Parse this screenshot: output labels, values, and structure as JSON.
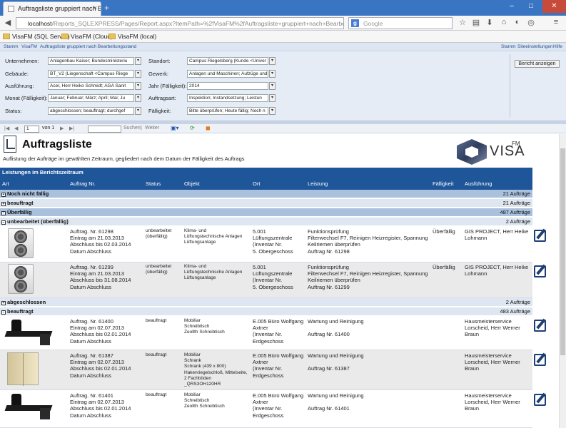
{
  "browser": {
    "tab_title": "Auftragsliste gruppiert nach Be...",
    "url_host": "localhost",
    "url_path": "/Reports_SQLEXPRESS/Pages/Report.aspx?ItemPath=%2fVisaFM%2fAuftragsliste+gruppiert+nach+Bearbeitungsstand&",
    "search_placeholder": "Google",
    "win_min": "–",
    "win_max": "□",
    "win_close": "✕",
    "tab_close": "×",
    "new_tab": "+",
    "bookmarks": [
      "VisaFM (SQL Server)",
      "VisaFM (Cloud)",
      "VisaFM (local)"
    ]
  },
  "crumbs": {
    "left": [
      "Stamm",
      "VisaFM",
      "Auftragsliste gruppiert nach Bearbeitungsstand"
    ],
    "right": [
      "Stamm",
      "Siteeinstellungen",
      "Hilfe"
    ]
  },
  "params": {
    "left": [
      {
        "label": "Unternehmen:",
        "value": "Anlagenbau Kaiser; Bundesministeriu"
      },
      {
        "label": "Gebäude:",
        "value": "BT_V2 (Liegenschaft <Campus Riege"
      },
      {
        "label": "Ausführung:",
        "value": "Acer, Herr Heiko Schmidt; AGA Sanit"
      },
      {
        "label": "Monat (Fälligkeit):",
        "value": "Januar; Februar; März; April; Mai; Ju"
      },
      {
        "label": "Status:",
        "value": "abgeschlossen; beauftragt; durchgef"
      }
    ],
    "right": [
      {
        "label": "Standort:",
        "value": "Campus Riegelsberg (Kunde <Univer"
      },
      {
        "label": "Gewerk:",
        "value": "Anlagen und Maschinen; Aufzüge und"
      },
      {
        "label": "Jahr (Fälligkeit):",
        "value": "2014"
      },
      {
        "label": "Auftragsart:",
        "value": "Inspektion; Instandsetzung; Leistun"
      },
      {
        "label": "Fälligkeit:",
        "value": "Bitte überprüfen; Heute fällig; Noch n"
      }
    ],
    "dropdown_glyph": "▾",
    "submit": "Bericht anzeigen"
  },
  "toolbar": {
    "page": "1",
    "of_label": "von 1",
    "find": "Suchen",
    "sep": "|",
    "next": "Weiter"
  },
  "report": {
    "title": "Auftragsliste",
    "subtitle": "Auflistung der Aufträge im gewählten Zeitraum, gegliedert nach dem Datum der Fälligkeit des Auftrags",
    "brand": "VISA",
    "brand_sup": "FM",
    "band": "Leistungen im Berichtszeitraum",
    "columns": [
      "Art",
      "Auftrag Nr.",
      "Status",
      "Objekt",
      "Ort",
      "Leistung",
      "Fälligkeit",
      "Ausführung"
    ],
    "groups": [
      {
        "label": "Noch nicht fällig",
        "count": "21 Aufträge"
      },
      {
        "label": "beauftragt",
        "count": "21 Aufträge"
      },
      {
        "label": "Überfällig",
        "count": "487 Aufträge"
      },
      {
        "label": "unbearbeitet (überfällig)",
        "count": "2 Aufträge"
      },
      {
        "label": "abgeschlossen",
        "count": "2 Aufträge"
      },
      {
        "label": "beauftragt",
        "count": "483 Aufträge"
      }
    ],
    "rows": [
      {
        "auftrag": "Auftrag. Nr. 61298\nEintrag am 21.03.2013\nAbschluss bis 02.03.2014\nDatum Abschluss",
        "status": "unbearbeitet\n(überfällig)",
        "objekt": "Klima- und\nLüftungstechnische Anlagen\nLüftungsanlage",
        "ort": "5.001\nLüftungszentrale\n(Inventar Nr.\n5. Obergeschoss",
        "leistung": "Funktionsprüfung\nFilterwechsel F7, Reinigen Heizregister, Spannung\nKeilriemen überprüfen\nAuftrag Nr. 61298",
        "faellig": "Überfällig",
        "ausfuehrung": "GIS PROJECT, Herr Heike\nLohmann"
      },
      {
        "auftrag": "Auftrag. Nr. 61299\nEintrag am 21.03.2013\nAbschluss bis 31.08.2014\nDatum Abschluss",
        "status": "unbearbeitet\n(überfällig)",
        "objekt": "Klima- und\nLüftungstechnische Anlagen\nLüftungsanlage",
        "ort": "5.001\nLüftungszentrale\n(Inventar Nr.\n5. Obergeschoss",
        "leistung": "Funktionsprüfung\nFilterwechsel F7, Reinigen Heizregister, Spannung\nKeilriemen überprüfen\nAuftrag Nr. 61299",
        "faellig": "Überfällig",
        "ausfuehrung": "GIS PROJECT, Herr Heike\nLohmann"
      },
      {
        "auftrag": "Auftrag. Nr. 61400\nEintrag am 02.07.2013\nAbschluss bis 02.01.2014\nDatum Abschluss",
        "status": "beauftragt",
        "objekt": "Mobiliar\nSchreibtisch\nZeollth Schreibtisch",
        "ort": "E.005 Büro Wolfgang\nAxtner\n(Inventar Nr.\nErdgeschoss",
        "leistung": "Wartung und Reinigung\n\nAuftrag Nr. 61400",
        "faellig": "",
        "ausfuehrung": "Hausmeisterservice\nLorscheid, Herr Werner\nBraun"
      },
      {
        "auftrag": "Auftrag. Nr. 61387\nEintrag am 02.07.2013\nAbschluss bis 02.01.2014\nDatum Abschluss",
        "status": "beauftragt",
        "objekt": "Mobiliar\nSchrank\nSchrank (439 x 800)\nHakenriegelschloß, Mittelseite,\n2 Fachböden\n_QRS3OH120HR",
        "ort": "E.005 Büro Wolfgang\nAxtner\n(Inventar Nr.\nErdgeschoss",
        "leistung": "Wartung und Reinigung\n\nAuftrag Nr. 61387",
        "faellig": "",
        "ausfuehrung": "Hausmeisterservice\nLorscheid, Herr Werner\nBraun"
      },
      {
        "auftrag": "Auftrag. Nr. 61401\nEintrag am 02.07.2013\nAbschluss bis 02.01.2014\nDatum Abschluss",
        "status": "beauftragt",
        "objekt": "Mobiliar\nSchreibtisch\nZeollth Schreibtisch",
        "ort": "E.005 Büro Wolfgang\nAxtner\n(Inventar Nr.\nErdgeschoss",
        "leistung": "Wartung und Reinigung\n\nAuftrag Nr. 61401",
        "faellig": "",
        "ausfuehrung": "Hausmeisterservice\nLorscheid, Herr Werner\nBraun"
      }
    ]
  }
}
